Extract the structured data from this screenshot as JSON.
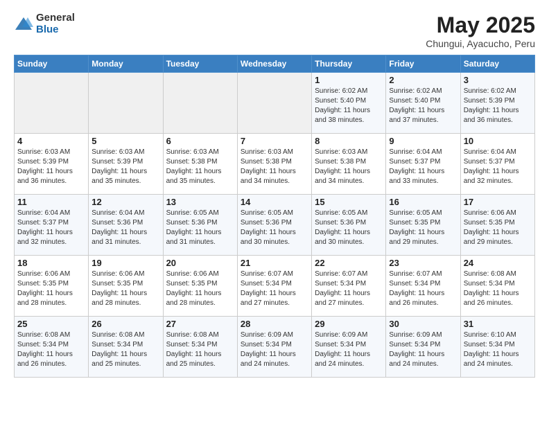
{
  "header": {
    "logo_general": "General",
    "logo_blue": "Blue",
    "title": "May 2025",
    "subtitle": "Chungui, Ayacucho, Peru"
  },
  "weekdays": [
    "Sunday",
    "Monday",
    "Tuesday",
    "Wednesday",
    "Thursday",
    "Friday",
    "Saturday"
  ],
  "weeks": [
    [
      {
        "day": "",
        "info": ""
      },
      {
        "day": "",
        "info": ""
      },
      {
        "day": "",
        "info": ""
      },
      {
        "day": "",
        "info": ""
      },
      {
        "day": "1",
        "info": "Sunrise: 6:02 AM\nSunset: 5:40 PM\nDaylight: 11 hours\nand 38 minutes."
      },
      {
        "day": "2",
        "info": "Sunrise: 6:02 AM\nSunset: 5:40 PM\nDaylight: 11 hours\nand 37 minutes."
      },
      {
        "day": "3",
        "info": "Sunrise: 6:02 AM\nSunset: 5:39 PM\nDaylight: 11 hours\nand 36 minutes."
      }
    ],
    [
      {
        "day": "4",
        "info": "Sunrise: 6:03 AM\nSunset: 5:39 PM\nDaylight: 11 hours\nand 36 minutes."
      },
      {
        "day": "5",
        "info": "Sunrise: 6:03 AM\nSunset: 5:39 PM\nDaylight: 11 hours\nand 35 minutes."
      },
      {
        "day": "6",
        "info": "Sunrise: 6:03 AM\nSunset: 5:38 PM\nDaylight: 11 hours\nand 35 minutes."
      },
      {
        "day": "7",
        "info": "Sunrise: 6:03 AM\nSunset: 5:38 PM\nDaylight: 11 hours\nand 34 minutes."
      },
      {
        "day": "8",
        "info": "Sunrise: 6:03 AM\nSunset: 5:38 PM\nDaylight: 11 hours\nand 34 minutes."
      },
      {
        "day": "9",
        "info": "Sunrise: 6:04 AM\nSunset: 5:37 PM\nDaylight: 11 hours\nand 33 minutes."
      },
      {
        "day": "10",
        "info": "Sunrise: 6:04 AM\nSunset: 5:37 PM\nDaylight: 11 hours\nand 32 minutes."
      }
    ],
    [
      {
        "day": "11",
        "info": "Sunrise: 6:04 AM\nSunset: 5:37 PM\nDaylight: 11 hours\nand 32 minutes."
      },
      {
        "day": "12",
        "info": "Sunrise: 6:04 AM\nSunset: 5:36 PM\nDaylight: 11 hours\nand 31 minutes."
      },
      {
        "day": "13",
        "info": "Sunrise: 6:05 AM\nSunset: 5:36 PM\nDaylight: 11 hours\nand 31 minutes."
      },
      {
        "day": "14",
        "info": "Sunrise: 6:05 AM\nSunset: 5:36 PM\nDaylight: 11 hours\nand 30 minutes."
      },
      {
        "day": "15",
        "info": "Sunrise: 6:05 AM\nSunset: 5:36 PM\nDaylight: 11 hours\nand 30 minutes."
      },
      {
        "day": "16",
        "info": "Sunrise: 6:05 AM\nSunset: 5:35 PM\nDaylight: 11 hours\nand 29 minutes."
      },
      {
        "day": "17",
        "info": "Sunrise: 6:06 AM\nSunset: 5:35 PM\nDaylight: 11 hours\nand 29 minutes."
      }
    ],
    [
      {
        "day": "18",
        "info": "Sunrise: 6:06 AM\nSunset: 5:35 PM\nDaylight: 11 hours\nand 28 minutes."
      },
      {
        "day": "19",
        "info": "Sunrise: 6:06 AM\nSunset: 5:35 PM\nDaylight: 11 hours\nand 28 minutes."
      },
      {
        "day": "20",
        "info": "Sunrise: 6:06 AM\nSunset: 5:35 PM\nDaylight: 11 hours\nand 28 minutes."
      },
      {
        "day": "21",
        "info": "Sunrise: 6:07 AM\nSunset: 5:34 PM\nDaylight: 11 hours\nand 27 minutes."
      },
      {
        "day": "22",
        "info": "Sunrise: 6:07 AM\nSunset: 5:34 PM\nDaylight: 11 hours\nand 27 minutes."
      },
      {
        "day": "23",
        "info": "Sunrise: 6:07 AM\nSunset: 5:34 PM\nDaylight: 11 hours\nand 26 minutes."
      },
      {
        "day": "24",
        "info": "Sunrise: 6:08 AM\nSunset: 5:34 PM\nDaylight: 11 hours\nand 26 minutes."
      }
    ],
    [
      {
        "day": "25",
        "info": "Sunrise: 6:08 AM\nSunset: 5:34 PM\nDaylight: 11 hours\nand 26 minutes."
      },
      {
        "day": "26",
        "info": "Sunrise: 6:08 AM\nSunset: 5:34 PM\nDaylight: 11 hours\nand 25 minutes."
      },
      {
        "day": "27",
        "info": "Sunrise: 6:08 AM\nSunset: 5:34 PM\nDaylight: 11 hours\nand 25 minutes."
      },
      {
        "day": "28",
        "info": "Sunrise: 6:09 AM\nSunset: 5:34 PM\nDaylight: 11 hours\nand 24 minutes."
      },
      {
        "day": "29",
        "info": "Sunrise: 6:09 AM\nSunset: 5:34 PM\nDaylight: 11 hours\nand 24 minutes."
      },
      {
        "day": "30",
        "info": "Sunrise: 6:09 AM\nSunset: 5:34 PM\nDaylight: 11 hours\nand 24 minutes."
      },
      {
        "day": "31",
        "info": "Sunrise: 6:10 AM\nSunset: 5:34 PM\nDaylight: 11 hours\nand 24 minutes."
      }
    ]
  ]
}
